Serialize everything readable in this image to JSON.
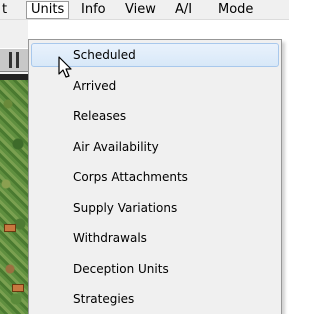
{
  "menubar": {
    "items": [
      {
        "label": "t"
      },
      {
        "label": "Units"
      },
      {
        "label": "Info"
      },
      {
        "label": "View"
      },
      {
        "label": "A/I"
      },
      {
        "label": "Mode"
      }
    ]
  },
  "units_menu": {
    "items": [
      {
        "label": "Scheduled"
      },
      {
        "label": "Arrived"
      },
      {
        "label": "Releases"
      },
      {
        "label": "Air Availability"
      },
      {
        "label": "Corps Attachments"
      },
      {
        "label": "Supply Variations"
      },
      {
        "label": "Withdrawals"
      },
      {
        "label": "Deception Units"
      },
      {
        "label": "Strategies"
      }
    ],
    "highlighted_item": "Scheduled"
  },
  "cursor": {
    "icon": "arrow-pointer-icon"
  },
  "colors": {
    "menu_background": "#f0f0f0",
    "highlight_fill": "#d8e8f8",
    "highlight_border": "#a8c8ec",
    "map_green": "#5f8f3f"
  }
}
